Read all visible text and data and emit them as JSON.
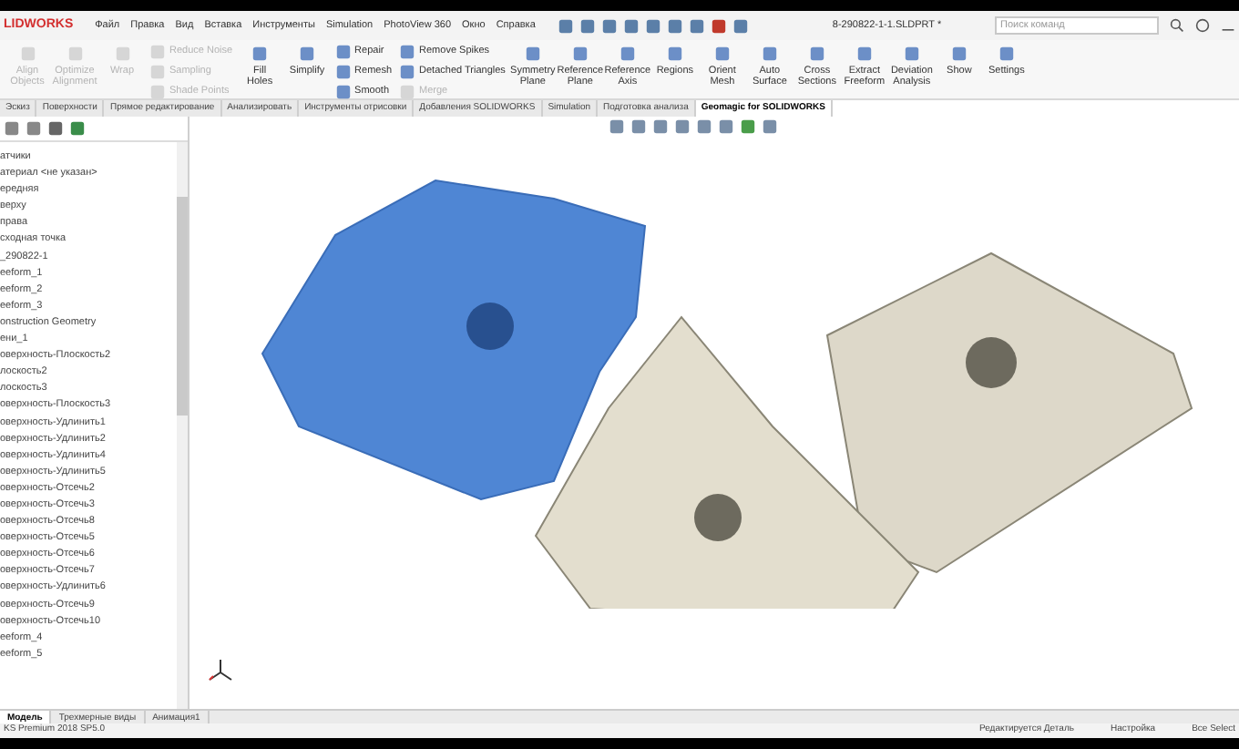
{
  "menu_bar": {
    "logo": "LIDWORKS",
    "items": [
      "Файл",
      "Правка",
      "Вид",
      "Вставка",
      "Инструменты",
      "Simulation",
      "PhotoView 360",
      "Окно",
      "Справка"
    ],
    "document_title": "8-290822-1-1.SLDPRT *",
    "search_placeholder": "Поиск команд"
  },
  "ribbon": {
    "columns": [
      {
        "kind": "large",
        "items": [
          {
            "label": "Align Objects",
            "disabled": true
          }
        ]
      },
      {
        "kind": "large",
        "items": [
          {
            "label": "Optimize Alignment",
            "disabled": true
          }
        ]
      },
      {
        "kind": "large",
        "items": [
          {
            "label": "Wrap",
            "disabled": true
          }
        ]
      },
      {
        "kind": "stack",
        "items": [
          {
            "label": "Reduce Noise",
            "disabled": true
          },
          {
            "label": "Sampling",
            "disabled": true
          },
          {
            "label": "Shade Points",
            "disabled": true
          }
        ]
      },
      {
        "kind": "large",
        "items": [
          {
            "label": "Fill Holes",
            "disabled": false
          }
        ]
      },
      {
        "kind": "large",
        "items": [
          {
            "label": "Simplify",
            "disabled": false
          }
        ]
      },
      {
        "kind": "stack",
        "items": [
          {
            "label": "Repair",
            "disabled": false
          },
          {
            "label": "Remesh",
            "disabled": false
          },
          {
            "label": "Smooth",
            "disabled": false
          }
        ]
      },
      {
        "kind": "stack",
        "items": [
          {
            "label": "Remove Spikes",
            "disabled": false
          },
          {
            "label": "Detached Triangles",
            "disabled": false
          },
          {
            "label": "Merge",
            "disabled": true
          }
        ]
      },
      {
        "kind": "large",
        "items": [
          {
            "label": "Symmetry Plane",
            "disabled": false
          }
        ]
      },
      {
        "kind": "large",
        "items": [
          {
            "label": "Reference Plane",
            "disabled": false
          }
        ]
      },
      {
        "kind": "large",
        "items": [
          {
            "label": "Reference Axis",
            "disabled": false
          }
        ]
      },
      {
        "kind": "large",
        "items": [
          {
            "label": "Regions",
            "disabled": false
          }
        ]
      },
      {
        "kind": "large",
        "items": [
          {
            "label": "Orient Mesh",
            "disabled": false
          }
        ]
      },
      {
        "kind": "large",
        "items": [
          {
            "label": "Auto Surface",
            "disabled": false
          }
        ]
      },
      {
        "kind": "large",
        "items": [
          {
            "label": "Cross Sections",
            "disabled": false
          }
        ]
      },
      {
        "kind": "large",
        "items": [
          {
            "label": "Extract Freeform",
            "disabled": false
          }
        ]
      },
      {
        "kind": "large",
        "items": [
          {
            "label": "Deviation Analysis",
            "disabled": false
          }
        ]
      },
      {
        "kind": "large",
        "items": [
          {
            "label": "Show",
            "disabled": false
          }
        ]
      },
      {
        "kind": "large",
        "items": [
          {
            "label": "Settings",
            "disabled": false
          }
        ]
      }
    ]
  },
  "command_tabs": [
    {
      "label": "Эскиз",
      "selected": false
    },
    {
      "label": "Поверхности",
      "selected": false
    },
    {
      "label": "Прямое редактирование",
      "selected": false
    },
    {
      "label": "Анализировать",
      "selected": false
    },
    {
      "label": "Инструменты отрисовки",
      "selected": false
    },
    {
      "label": "Добавления SOLIDWORKS",
      "selected": false
    },
    {
      "label": "Simulation",
      "selected": false
    },
    {
      "label": "Подготовка анализа",
      "selected": false
    },
    {
      "label": "Geomagic for SOLIDWORKS",
      "selected": true
    }
  ],
  "feature_tree": {
    "items": [
      "атчики",
      "атериал <не указан>",
      "ередняя",
      "верху",
      "права",
      "сходная точка",
      "_290822-1",
      "eeform_1",
      "eeform_2",
      "eeform_3",
      "onstruction Geometry",
      "ени_1",
      "оверхность-Плоскость2",
      "лоскость2",
      "лоскость3",
      "оверхность-Плоскость3",
      "оверхность-Удлинить1",
      "оверхность-Удлинить2",
      "оверхность-Удлинить4",
      "оверхность-Удлинить5",
      "оверхность-Отсечь2",
      "оверхность-Отсечь3",
      "оверхность-Отсечь8",
      "оверхность-Отсечь5",
      "оверхность-Отсечь6",
      "оверхность-Отсечь7",
      "оверхность-Удлинить6",
      "оверхность-Отсечь9",
      "оверхность-Отсечь10",
      "eeform_4",
      "eeform_5"
    ]
  },
  "bottom_tabs": [
    {
      "label": "Модель",
      "selected": true
    },
    {
      "label": "Трехмерные виды",
      "selected": false
    },
    {
      "label": "Анимация1",
      "selected": false
    }
  ],
  "status_bar": {
    "left": "KS Premium 2018 SP5.0",
    "items": [
      "Редактируется Деталь",
      "Настройка",
      "Все Select"
    ]
  }
}
